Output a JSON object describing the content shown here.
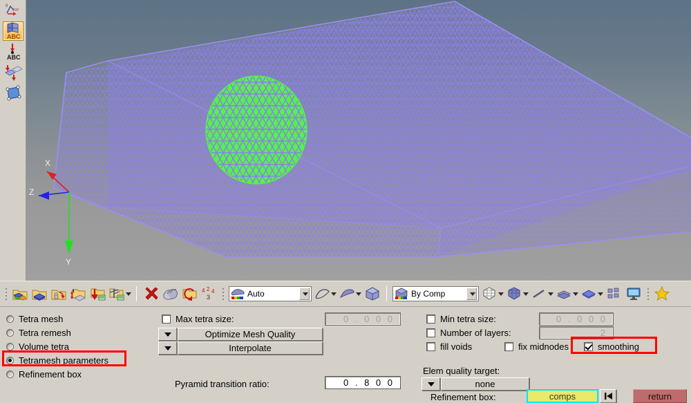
{
  "app": {
    "title": "Tetramesh parameters"
  },
  "left_toolbar": {
    "items": [
      {
        "name": "rotate-angle-icon",
        "label": "Rotate by angle"
      },
      {
        "name": "node-edit-abc-icon",
        "label": "Node edit ABC",
        "selected": true
      },
      {
        "name": "node-abc-icon",
        "label": "Node ABC"
      },
      {
        "name": "translate-elements-icon",
        "label": "Translate elements"
      },
      {
        "name": "surface-patch-icon",
        "label": "Surface patch"
      }
    ]
  },
  "viewport": {
    "axis_triad": {
      "x_label": "X",
      "y_label": "Y",
      "z_label": "Z",
      "x_color": "#e02020",
      "y_color": "#20e020",
      "z_color": "#2020f0"
    },
    "mesh_color": "#8d7ef0",
    "highlight_color": "#55f24a",
    "background_top": "#5d7385",
    "background_bottom": "#a0a0a0"
  },
  "toolbar": {
    "groups": [
      {
        "name": "collector-group",
        "items": [
          {
            "name": "components-icon",
            "label": "Collectors"
          },
          {
            "name": "component-create-icon",
            "label": "Component"
          },
          {
            "name": "assembly-icon",
            "label": "Assembly"
          },
          {
            "name": "include-icon",
            "label": "Include"
          },
          {
            "name": "import-icon",
            "label": "Import"
          },
          {
            "name": "organize-icon",
            "label": "Organize",
            "has_caret": true
          }
        ]
      },
      {
        "name": "edit-group",
        "items": [
          {
            "name": "delete-icon",
            "label": "Delete"
          },
          {
            "name": "mask-icon",
            "label": "Mask"
          },
          {
            "name": "find-icon",
            "label": "Find"
          },
          {
            "name": "renumber-icon",
            "label": "Renumber"
          }
        ]
      }
    ],
    "color_mode_combo": {
      "name": "visualization-mode-combo",
      "value": "Auto",
      "icon": "shaded-elements-icon"
    },
    "geom_items": [
      {
        "name": "wireframe-geom-icon",
        "label": "Wireframe geometry",
        "has_caret": true
      },
      {
        "name": "shaded-geom-icon",
        "label": "Shaded geometry",
        "has_caret": true
      },
      {
        "name": "shaded-solid-icon",
        "label": "Shaded solid"
      }
    ],
    "color_by_combo": {
      "name": "color-by-combo",
      "value": "By Comp",
      "icon": "cube-color-icon"
    },
    "display_items": [
      {
        "name": "wireframe-mesh-icon",
        "label": "Wireframe mesh",
        "has_caret": true
      },
      {
        "name": "shaded-mesh-icon",
        "label": "Shaded mesh",
        "has_caret": true
      },
      {
        "name": "element-lines-icon",
        "label": "Element lines",
        "has_caret": true
      },
      {
        "name": "element-faces-icon",
        "label": "Element faces",
        "has_caret": true
      },
      {
        "name": "shrink-elements-icon",
        "label": "Shrink elements",
        "has_caret": true
      },
      {
        "name": "window-tile-icon",
        "label": "Tile windows"
      },
      {
        "name": "display-monitor-icon",
        "label": "Graphics display"
      }
    ],
    "favorite": {
      "name": "favorites-star-icon",
      "label": "Favorites"
    }
  },
  "panel": {
    "mode_radios": [
      {
        "name": "radio-tetra-mesh",
        "label": "Tetra mesh",
        "selected": false
      },
      {
        "name": "radio-tetra-remesh",
        "label": "Tetra remesh",
        "selected": false
      },
      {
        "name": "radio-volume-tetra",
        "label": "Volume tetra",
        "selected": false
      },
      {
        "name": "radio-tetramesh-parameters",
        "label": "Tetramesh parameters",
        "selected": true,
        "highlighted": true
      },
      {
        "name": "radio-refinement-box",
        "label": "Refinement box",
        "selected": false
      }
    ],
    "max_tetra_size": {
      "label": "Max tetra size:",
      "checked": false,
      "value": "0 . 0 0 0",
      "enabled": false
    },
    "optimize_mesh_quality": {
      "label": "Optimize Mesh Quality"
    },
    "interpolate": {
      "label": "Interpolate"
    },
    "pyramid_transition_ratio": {
      "label": "Pyramid transition ratio:",
      "value": "0 . 8 0 0"
    },
    "min_tetra_size": {
      "label": "Min tetra size:",
      "checked": false,
      "value": "0 . 0 0 0",
      "enabled": false
    },
    "number_of_layers": {
      "label": "Number of layers:",
      "checked": false,
      "value": "2",
      "enabled": false
    },
    "fill_voids": {
      "label": "fill voids",
      "checked": false
    },
    "fix_midnodes": {
      "label": "fix midnodes",
      "checked": false
    },
    "smoothing": {
      "label": "smoothing",
      "checked": true,
      "highlighted": true
    },
    "elem_quality_target": {
      "label": "Elem quality target:",
      "value": "none"
    },
    "refinement_box": {
      "label": "Refinement box:",
      "entity_button": "comps"
    },
    "return_button": {
      "label": "return"
    },
    "highlight_color": "#ff0000"
  }
}
